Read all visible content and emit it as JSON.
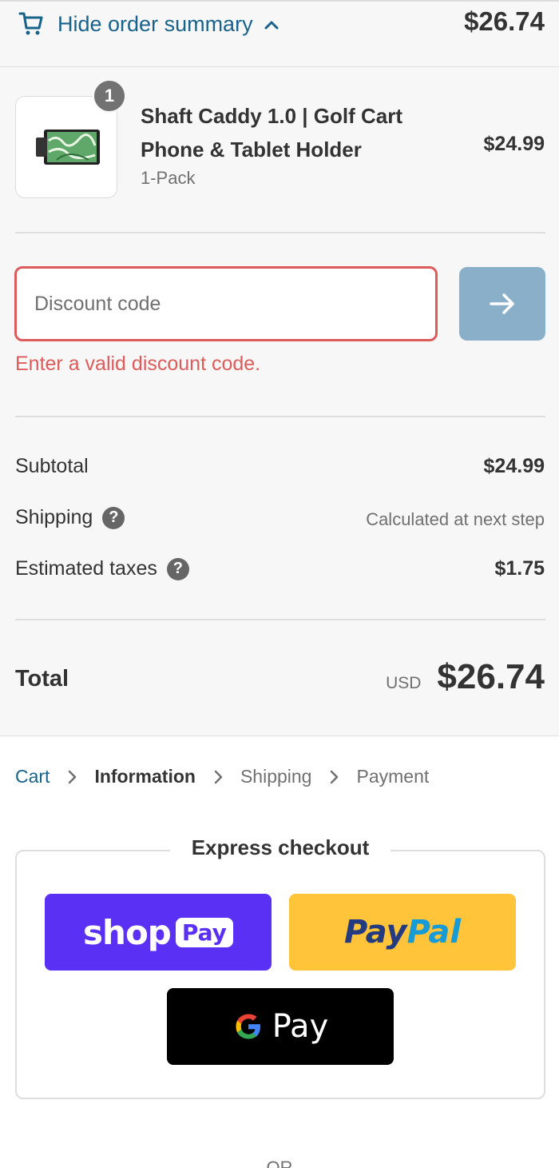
{
  "header": {
    "toggle_label": "Hide order summary",
    "total": "$26.74"
  },
  "product": {
    "name": "Shaft Caddy 1.0 | Golf Cart Phone & Tablet Holder",
    "variant": "1-Pack",
    "price": "$24.99",
    "quantity": "1"
  },
  "discount": {
    "placeholder": "Discount code",
    "error": "Enter a valid discount code."
  },
  "costs": {
    "subtotal_label": "Subtotal",
    "subtotal_value": "$24.99",
    "shipping_label": "Shipping",
    "shipping_value": "Calculated at next step",
    "taxes_label": "Estimated taxes",
    "taxes_value": "$1.75",
    "total_label": "Total",
    "total_currency": "USD",
    "total_value": "$26.74"
  },
  "breadcrumb": {
    "items": [
      "Cart",
      "Information",
      "Shipping",
      "Payment"
    ]
  },
  "express": {
    "title": "Express checkout",
    "shoppay_shop": "shop",
    "shoppay_pay": "Pay",
    "paypal_pay": "Pay",
    "paypal_pal": "Pal",
    "gpay_word": "Pay",
    "or_label": "OR"
  },
  "colors": {
    "link": "#19628a",
    "error": "#dd5b5b",
    "shoppay": "#5a31f4",
    "paypal": "#ffc439",
    "gpay": "#000000",
    "apply_button": "#8aafc8"
  },
  "icons": {
    "cart": "cart-icon",
    "toggle_chevron": "chevron-up-icon",
    "apply": "arrow-right-icon",
    "help": "question-circle-icon",
    "breadcrumb_separator": "chevron-right-icon",
    "google": "google-g-icon"
  }
}
